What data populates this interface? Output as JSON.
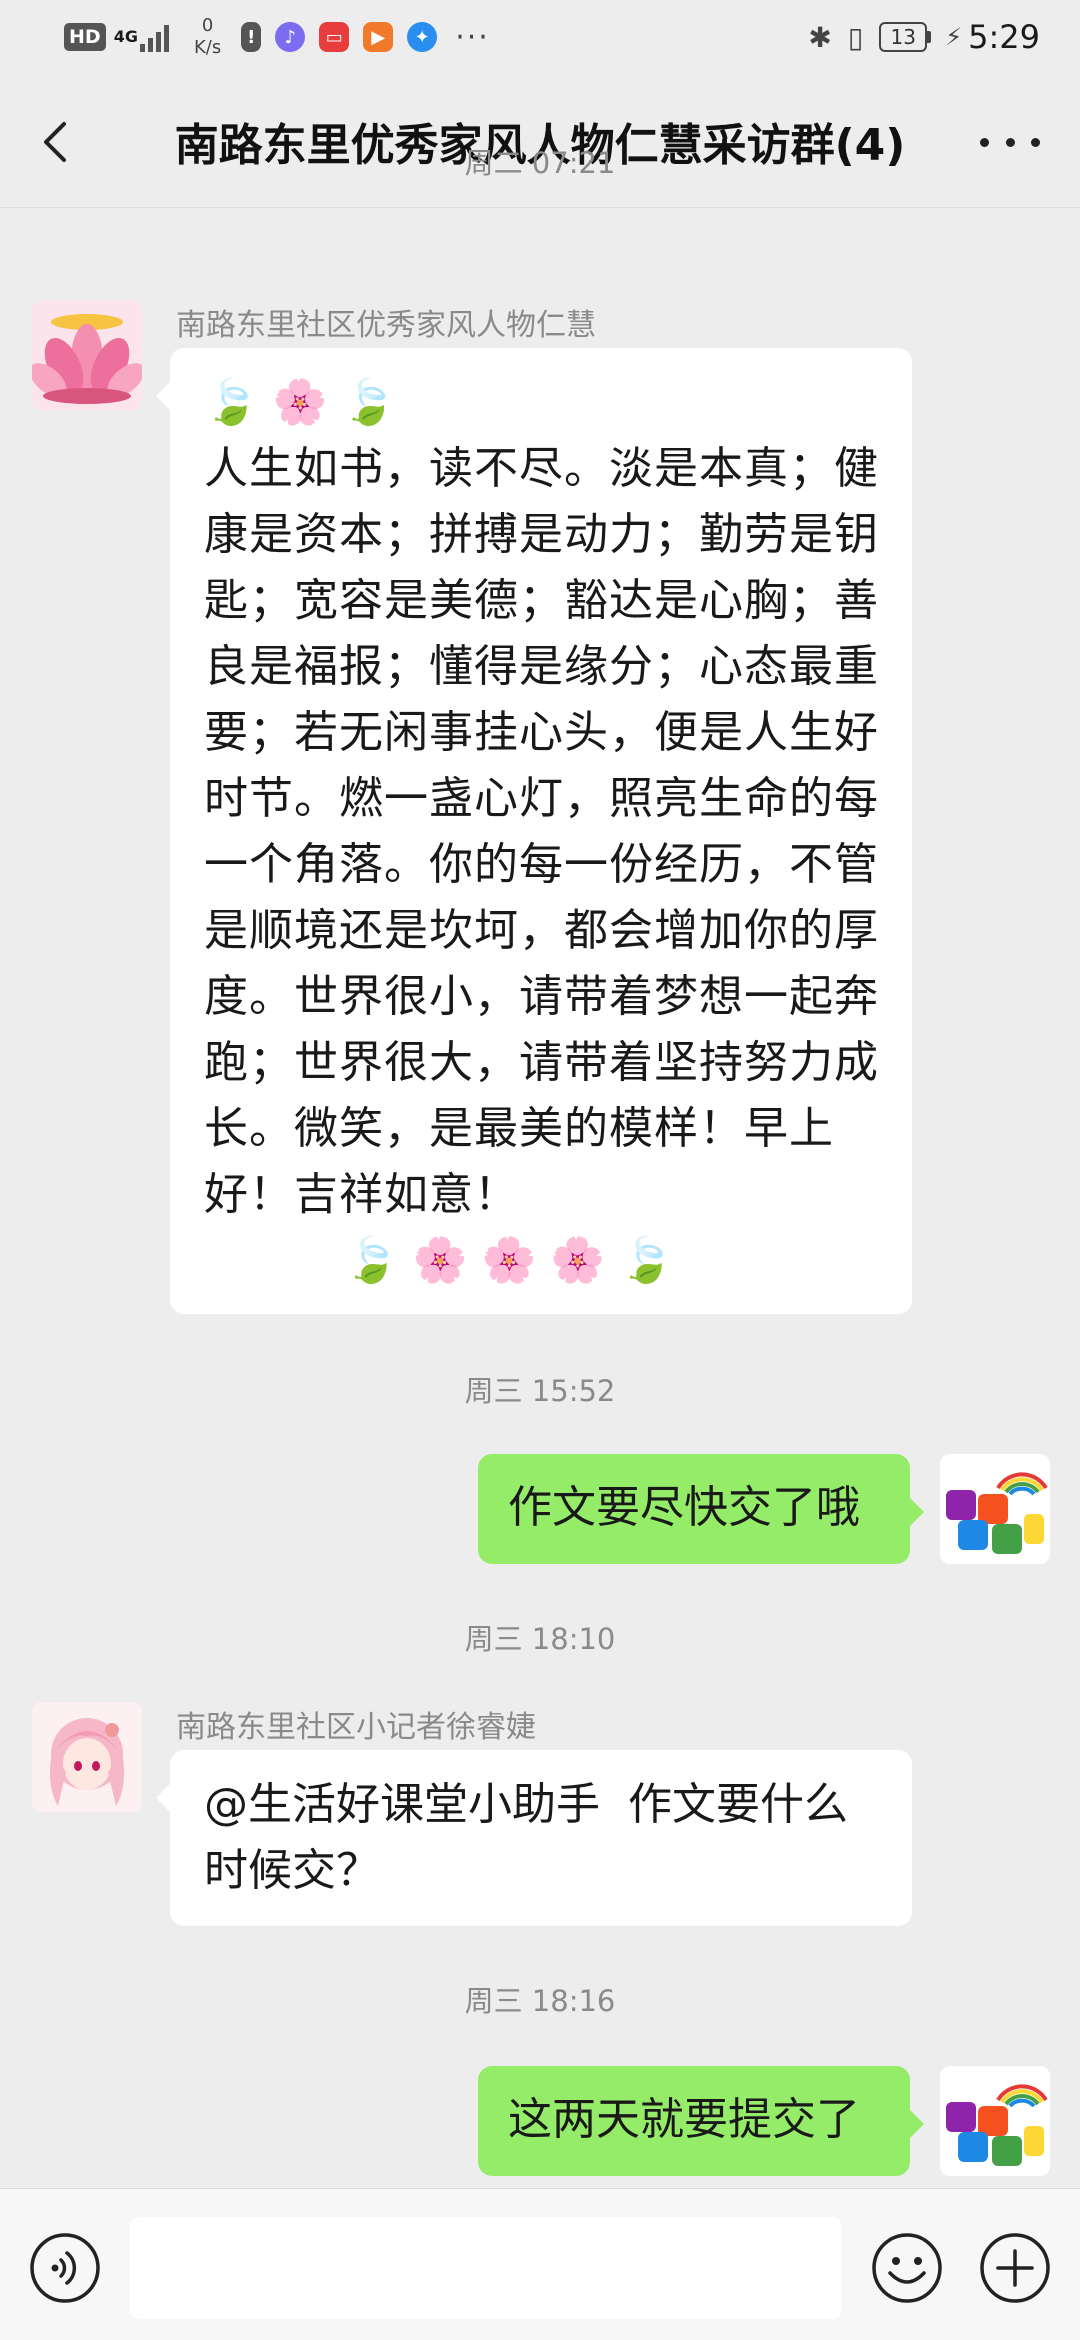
{
  "status_bar": {
    "hd": "HD",
    "network": "4G",
    "speed_value": "0",
    "speed_unit": "K/s",
    "more": "···",
    "battery": "13",
    "time": "5:29"
  },
  "header": {
    "title": "南路东里优秀家风人物仁慧采访群(4)"
  },
  "messages": [
    {
      "timestamp": "周二 07:21",
      "sender": "南路东里社区优秀家风人物仁慧",
      "side": "left",
      "emoji_top": "🍃 🌸 🍃",
      "text": "人生如书，读不尽。淡是本真；健康是资本；拼搏是动力；勤劳是钥匙；宽容是美德；豁达是心胸；善良是福报；懂得是缘分；心态最重要；若无闲事挂心头，便是人生好时节。燃一盏心灯，照亮生命的每一个角落。你的每一份经历，不管是顺境还是坎坷，都会增加你的厚度。世界很小，请带着梦想一起奔跑；世界很大，请带着坚持努力成长。微笑，是最美的模样！早上好！吉祥如意！",
      "emoji_bottom": "🍃 🌸 🌸 🌸 🍃"
    },
    {
      "timestamp": "周三 15:52",
      "side": "right",
      "text": "作文要尽快交了哦"
    },
    {
      "timestamp": "周三 18:10",
      "sender": "南路东里社区小记者徐睿婕",
      "side": "left",
      "text": "@生活好课堂小助手  作文要什么时候交？"
    },
    {
      "timestamp": "周三 18:16",
      "side": "right",
      "text": "这两天就要提交了"
    }
  ],
  "input": {
    "placeholder": ""
  },
  "icons": {
    "back": "back-arrow-icon",
    "more": "more-dots-icon",
    "voice": "voice-icon",
    "emoji": "emoji-icon",
    "plus": "plus-icon"
  },
  "colors": {
    "background": "#ededed",
    "bubble_self": "#95ec69",
    "bubble_other": "#ffffff",
    "timestamp": "#8a8a8a"
  }
}
